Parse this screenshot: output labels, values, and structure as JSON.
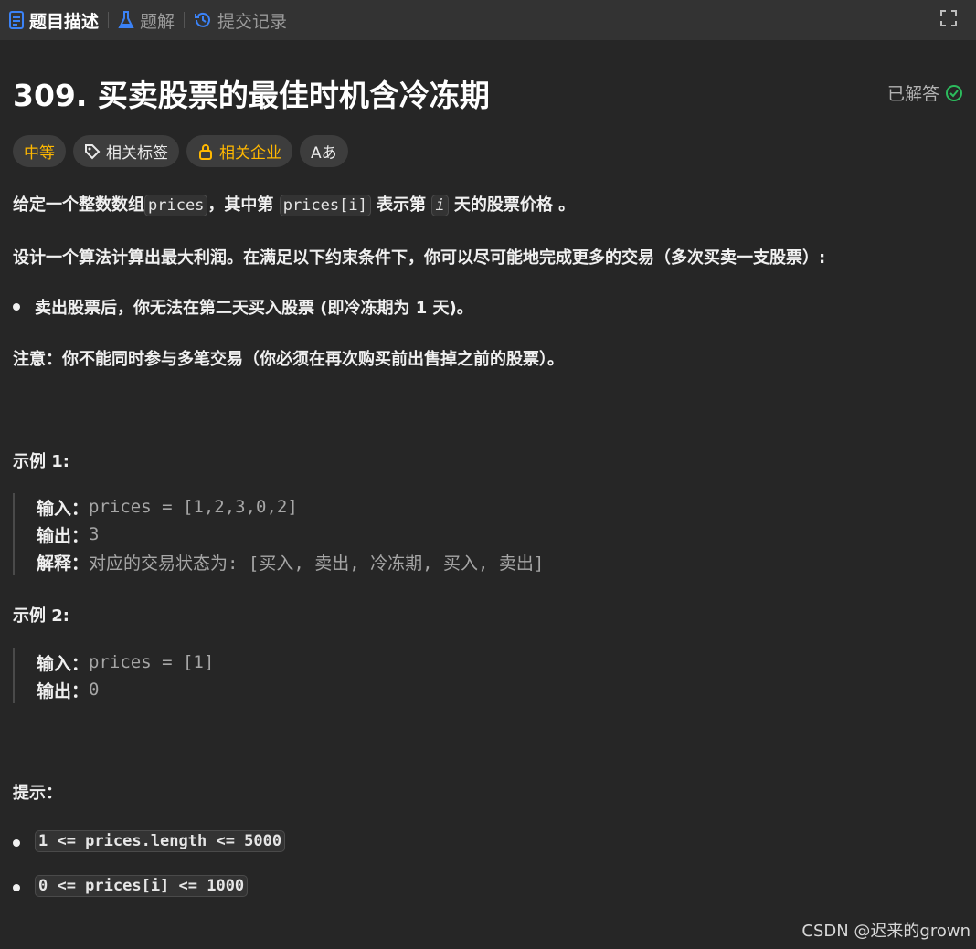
{
  "tabs": [
    {
      "label": "题目描述",
      "icon": "document-icon",
      "active": true
    },
    {
      "label": "题解",
      "icon": "flask-icon",
      "active": false
    },
    {
      "label": "提交记录",
      "icon": "history-icon",
      "active": false
    }
  ],
  "problem": {
    "title": "309. 买卖股票的最佳时机含冷冻期",
    "status": "已解答",
    "tags": {
      "difficulty": "中等",
      "related_tags": "相关标签",
      "related_companies": "相关企业",
      "translate": "Aあ"
    }
  },
  "description": {
    "line1_a": "给定一个整数数组",
    "line1_code1": "prices",
    "line1_b": "，其中第 ",
    "line1_code2": "prices[i]",
    "line1_c": " 表示第 ",
    "line1_code3": "i",
    "line1_d": " 天的股票价格 。",
    "line2": "设计一个算法计算出最大利润。在满足以下约束条件下，你可以尽可能地完成更多的交易（多次买卖一支股票）:",
    "bullet1": "卖出股票后，你无法在第二天买入股票 (即冷冻期为 1 天)。",
    "note_label": "注意：",
    "note_text": "你不能同时参与多笔交易（你必须在再次购买前出售掉之前的股票）。"
  },
  "examples": [
    {
      "heading": "示例 1:",
      "input_label": "输入：",
      "input_value": "prices = [1,2,3,0,2]",
      "output_label": "输出：",
      "output_value": "3",
      "explain_label": "解释：",
      "explain_value": "对应的交易状态为: [买入, 卖出, 冷冻期, 买入, 卖出]"
    },
    {
      "heading": "示例 2:",
      "input_label": "输入：",
      "input_value": "prices = [1]",
      "output_label": "输出：",
      "output_value": "0"
    }
  ],
  "hints": {
    "heading": "提示：",
    "items": [
      "1 <= prices.length <= 5000",
      "0 <= prices[i] <= 1000"
    ]
  },
  "watermark": "CSDN @迟来的grown",
  "colors": {
    "accent_blue": "#3b82f6",
    "solved_green": "#2cbb5d",
    "difficulty_yellow": "#ffb800"
  }
}
